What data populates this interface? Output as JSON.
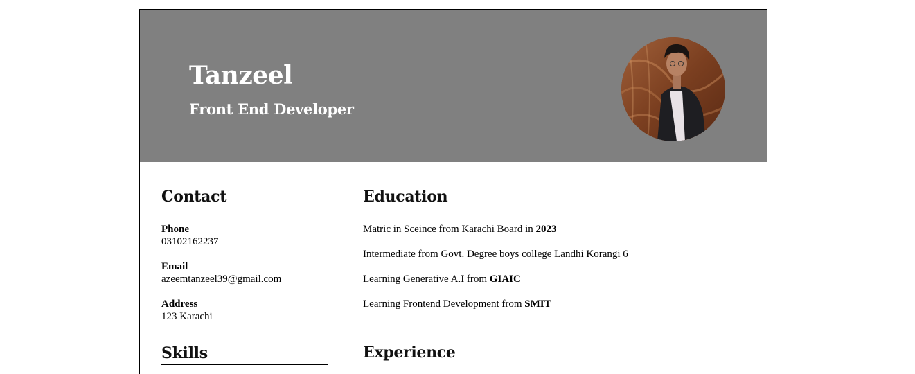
{
  "header": {
    "name": "Tanzeel",
    "role": "Front End Developer",
    "background_color": "#808080",
    "text_color": "#ffffff"
  },
  "contact": {
    "title": "Contact",
    "items": [
      {
        "label": "Phone",
        "value": "03102162237"
      },
      {
        "label": "Email",
        "value": "azeemtanzeel39@gmail.com"
      },
      {
        "label": "Address",
        "value": "123 Karachi"
      }
    ]
  },
  "skills": {
    "title": "Skills"
  },
  "education": {
    "title": "Education",
    "items": [
      {
        "text": "Matric in Sceince from Karachi Board in ",
        "bold": "2023"
      },
      {
        "text": "Intermediate from Govt. Degree boys college Landhi Korangi 6",
        "bold": ""
      },
      {
        "text": "Learning Generative A.I from ",
        "bold": "GIAIC"
      },
      {
        "text": "Learning Frontend Development from ",
        "bold": "SMIT"
      }
    ]
  },
  "experience": {
    "title": "Experience"
  }
}
